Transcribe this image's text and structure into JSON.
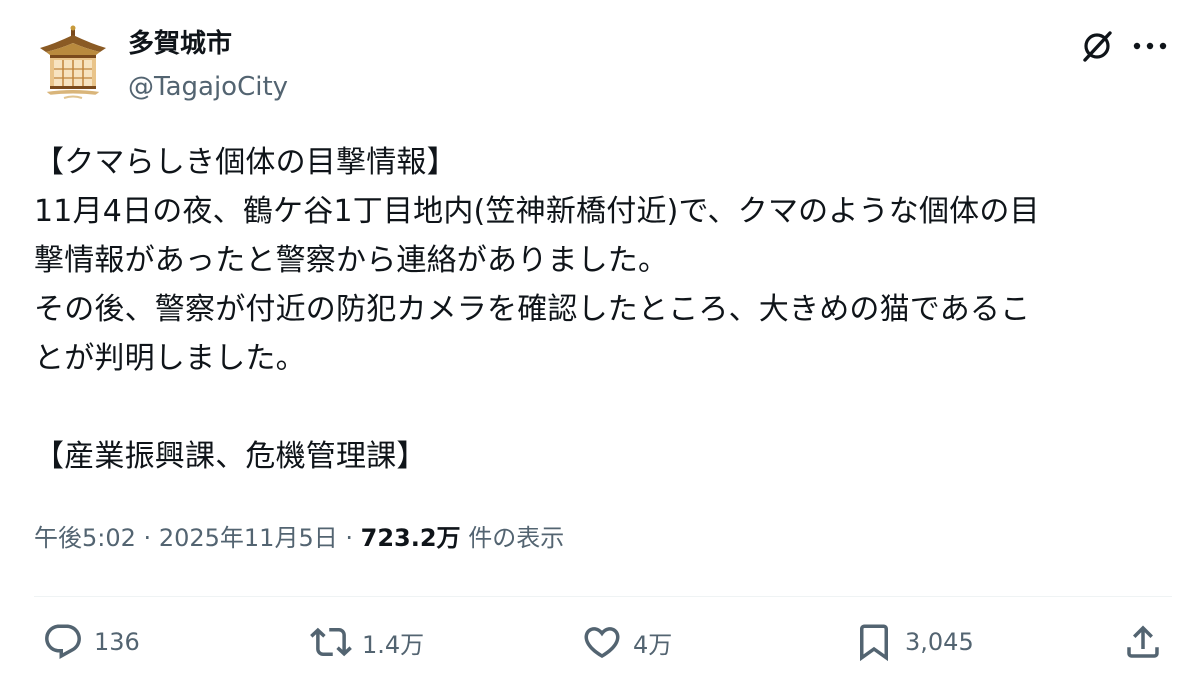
{
  "author": {
    "name": "多賀城市",
    "handle": "@TagajoCity",
    "avatar_icon": "pavilion-roof-icon"
  },
  "header_icons": {
    "grok": "grok-slash-icon",
    "more": "more-dots-icon"
  },
  "post": {
    "lines": [
      "【クマらしき個体の目撃情報】",
      "11月4日の夜、鶴ケ谷1丁目地内(笠神新橋付近)で、クマのような個体の目",
      "撃情報があったと警察から連絡がありました。",
      "その後、警察が付近の防犯カメラを確認したところ、大きめの猫であるこ",
      "とが判明しました。",
      "",
      "【産業振興課、危機管理課】"
    ]
  },
  "meta": {
    "time": "午後5:02",
    "separator": "·",
    "date": "2025年11月5日",
    "views_count": "723.2万",
    "views_label": "件の表示"
  },
  "actions": {
    "replies": "136",
    "reposts": "1.4万",
    "likes": "4万",
    "bookmarks": "3,045"
  },
  "colors": {
    "text": "#0f1419",
    "secondary": "#536471",
    "divider": "#eff3f4"
  }
}
